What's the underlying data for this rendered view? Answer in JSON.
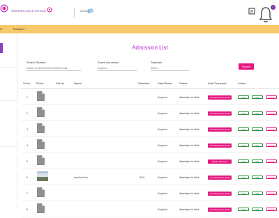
{
  "header": {
    "school_name": "SHAHEEN CHILD SCHOOL",
    "session": "2022-2023",
    "notification_count": "2"
  },
  "nav": {
    "items": [
      {
        "label": "er"
      },
      {
        "label": "Transport"
      }
    ]
  },
  "page": {
    "title": "Admission List"
  },
  "filters": {
    "search_label": "Search Student",
    "search_placeholder": "Search by Name/Father/Mobile/Email",
    "status_label": "Search by status",
    "status_value": "Enquired",
    "standard_label": "Standard",
    "standard_value": "Select",
    "search_button": "Search"
  },
  "table": {
    "columns": [
      "Sr.No.",
      "Photo",
      "Std No.",
      "Name",
      "Standard",
      "Date/Status",
      "Status",
      "Avail Transport",
      "Action"
    ],
    "rows": [
      {
        "sr": "1",
        "name": "",
        "standard": "",
        "date_status": "Enquired",
        "status": "Admission in Hold",
        "transport": "Link Pick & Drop Point",
        "has_photo": false
      },
      {
        "sr": "2",
        "name": "",
        "standard": "",
        "date_status": "Enquired",
        "status": "Admission in Hold",
        "transport": "Link Pick & Drop Point",
        "has_photo": false
      },
      {
        "sr": "3",
        "name": "",
        "standard": "",
        "date_status": "Enquired",
        "status": "Admission in Hold",
        "transport": "Link Pick & Drop Point",
        "has_photo": false
      },
      {
        "sr": "4",
        "name": "",
        "standard": "",
        "date_status": "Enquired",
        "status": "Admission in Hold",
        "transport": "Link Pick & Drop Point",
        "has_photo": false
      },
      {
        "sr": "5",
        "name": "",
        "standard": "",
        "date_status": "Enquired",
        "status": "Admission in Hold",
        "transport": "Modify Transport",
        "has_photo": false
      },
      {
        "sr": "6",
        "name": "Amelia Khan",
        "standard": "SKG",
        "date_status": "Enquired",
        "status": "Admission in Hold",
        "transport": "Link Pick & Drop Point",
        "has_photo": true
      },
      {
        "sr": "7",
        "name": "",
        "standard": "",
        "date_status": "Enquired",
        "status": "Admission in Hold",
        "transport": "Link Pick & Drop Point",
        "has_photo": false
      },
      {
        "sr": "8",
        "name": "",
        "standard": "",
        "date_status": "Enquired",
        "status": "Admission in Hold",
        "transport": "Link Pick & Drop Point",
        "has_photo": false
      }
    ],
    "actions": {
      "view": "View",
      "edit": "Edit",
      "delete": "Delete"
    }
  },
  "colors": {
    "accent": "#e4177f",
    "title": "#b52ed1",
    "navbar": "#f7c96a",
    "sidebar_active": "#8e3cc0"
  }
}
